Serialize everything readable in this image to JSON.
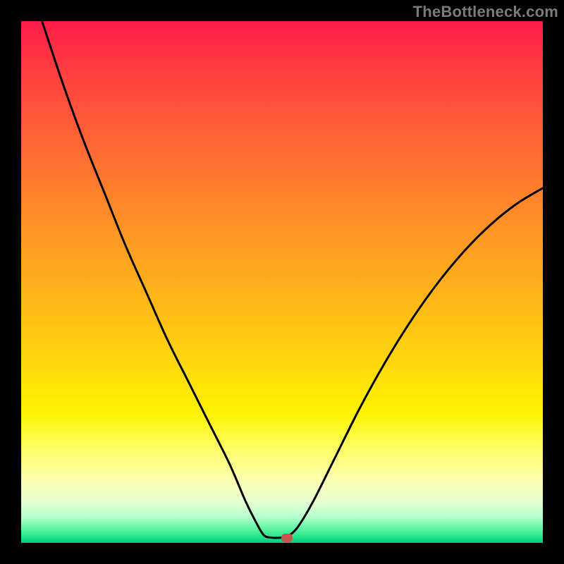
{
  "attribution": "TheBottleneck.com",
  "chart_data": {
    "type": "line",
    "title": "",
    "xlabel": "",
    "ylabel": "",
    "xlim": [
      0,
      100
    ],
    "ylim": [
      0,
      100
    ],
    "curve_points": [
      {
        "x": 4,
        "y": 100
      },
      {
        "x": 8,
        "y": 88
      },
      {
        "x": 12,
        "y": 77
      },
      {
        "x": 16,
        "y": 67
      },
      {
        "x": 20,
        "y": 57
      },
      {
        "x": 24,
        "y": 48
      },
      {
        "x": 28,
        "y": 39
      },
      {
        "x": 32,
        "y": 31
      },
      {
        "x": 36,
        "y": 23
      },
      {
        "x": 40,
        "y": 15
      },
      {
        "x": 43,
        "y": 8
      },
      {
        "x": 45,
        "y": 4
      },
      {
        "x": 46.5,
        "y": 1.5
      },
      {
        "x": 48,
        "y": 1
      },
      {
        "x": 50,
        "y": 1
      },
      {
        "x": 51,
        "y": 1.2
      },
      {
        "x": 53,
        "y": 3
      },
      {
        "x": 56,
        "y": 8
      },
      {
        "x": 60,
        "y": 16
      },
      {
        "x": 65,
        "y": 26
      },
      {
        "x": 70,
        "y": 35
      },
      {
        "x": 75,
        "y": 43
      },
      {
        "x": 80,
        "y": 50
      },
      {
        "x": 85,
        "y": 56
      },
      {
        "x": 90,
        "y": 61
      },
      {
        "x": 95,
        "y": 65
      },
      {
        "x": 100,
        "y": 68
      }
    ],
    "marker": {
      "x": 51,
      "y": 1
    },
    "background_gradient": {
      "top_color": "#ff1c4a",
      "mid_color": "#ffd60d",
      "bottom_color": "#00c97a"
    }
  }
}
